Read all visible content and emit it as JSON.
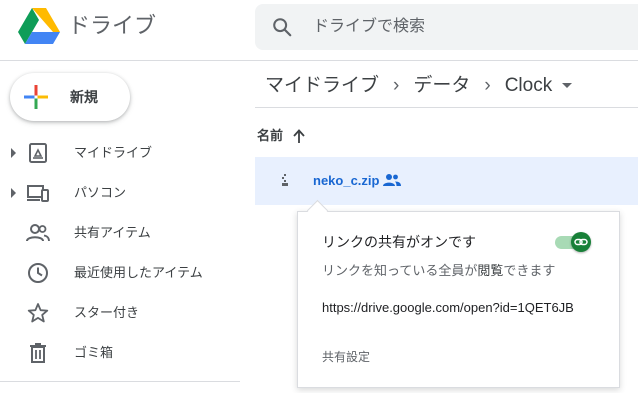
{
  "app": {
    "title": "ドライブ"
  },
  "search": {
    "placeholder": "ドライブで検索"
  },
  "sidebar": {
    "new_label": "新規",
    "items": [
      {
        "label": "マイドライブ",
        "icon": "my-drive-icon",
        "expandable": true
      },
      {
        "label": "パソコン",
        "icon": "computers-icon",
        "expandable": true
      },
      {
        "label": "共有アイテム",
        "icon": "shared-people-icon",
        "expandable": false
      },
      {
        "label": "最近使用したアイテム",
        "icon": "clock-icon",
        "expandable": false
      },
      {
        "label": "スター付き",
        "icon": "star-icon",
        "expandable": false
      },
      {
        "label": "ゴミ箱",
        "icon": "trash-icon",
        "expandable": false
      }
    ]
  },
  "breadcrumb": [
    "マイドライブ",
    "データ",
    "Clock"
  ],
  "list": {
    "column_name": "名前",
    "files": [
      {
        "name": "neko_c.zip",
        "shared": true
      }
    ]
  },
  "share_popup": {
    "title": "リンクの共有がオンです",
    "desc_prefix": "リンクを知っている全員が",
    "desc_bold": "閲覧",
    "desc_suffix": "できます",
    "url": "https://drive.google.com/open?id=1QET6JB",
    "settings_label": "共有設定",
    "toggle_on": true
  },
  "colors": {
    "accent_blue": "#1967d2",
    "selected_row": "#e8f0fe",
    "toggle_green": "#188038"
  }
}
